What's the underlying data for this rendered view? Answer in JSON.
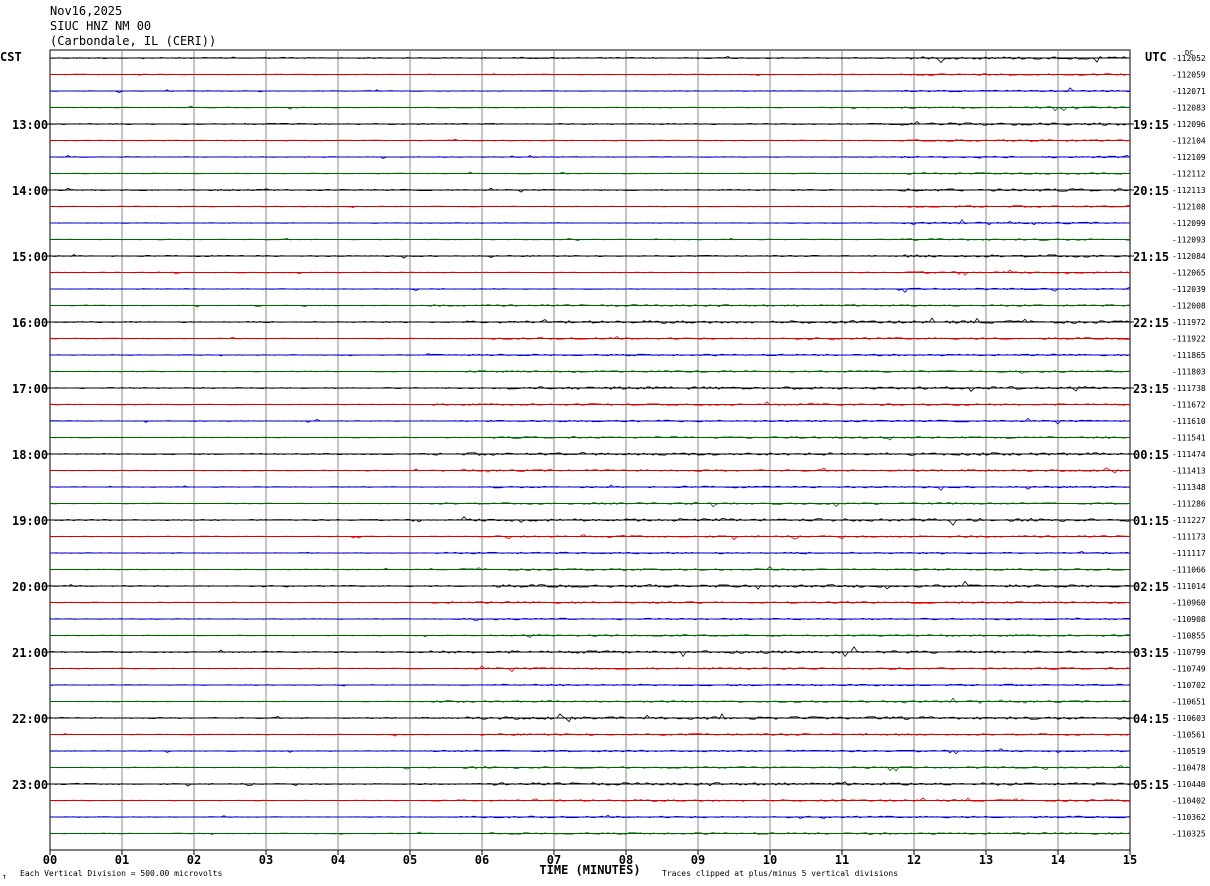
{
  "header": {
    "date": "Nov16,2025",
    "station": "SIUC HNZ NM 00",
    "location": "(Carbondale, IL (CERI))"
  },
  "labels": {
    "left_tz": "CST",
    "right_tz": "UTC",
    "dc": "DC",
    "footer_left": "Each Vertical Division =  500.00 microvolts",
    "footer_right": "Traces clipped at plus/minus 5 vertical divisions",
    "mark": "↑"
  },
  "colors": {
    "cycle": [
      "#000000",
      "#dd0000",
      "#0000cc",
      "#006600"
    ],
    "grid": "#888888"
  },
  "chart_data": {
    "type": "line",
    "xlabel": "TIME (MINUTES)",
    "x_ticks": [
      "00",
      "01",
      "02",
      "03",
      "04",
      "05",
      "06",
      "07",
      "08",
      "09",
      "10",
      "11",
      "12",
      "13",
      "14",
      "15"
    ],
    "xlim": [
      0,
      15
    ],
    "rows_per_hour": 4,
    "minutes_per_row": 15,
    "left_hours": [
      "13:00",
      "14:00",
      "15:00",
      "16:00",
      "17:00",
      "18:00",
      "19:00",
      "20:00",
      "21:00",
      "22:00",
      "23:00"
    ],
    "right_hours": [
      "19:15",
      "20:15",
      "21:15",
      "22:15",
      "23:15",
      "00:15",
      "01:15",
      "02:15",
      "03:15",
      "04:15",
      "05:15"
    ],
    "dc_offsets": [
      "-112052",
      "-112059",
      "-112071",
      "-112083",
      "-112096",
      "-112104",
      "-112109",
      "-112112",
      "-112113",
      "-112108",
      "-112099",
      "-112093",
      "-112084",
      "-112065",
      "-112039",
      "-112008",
      "-111972",
      "-111922",
      "-111865",
      "-111803",
      "-111738",
      "-111672",
      "-111610",
      "-111541",
      "-111474",
      "-111413",
      "-111348",
      "-111286",
      "-111227",
      "-111173",
      "-111117",
      "-111066",
      "-111014",
      "-110960",
      "-110908",
      "-110855",
      "-110799",
      "-110749",
      "-110702",
      "-110651",
      "-110603",
      "-110561",
      "-110519",
      "-110478",
      "-110440",
      "-110402",
      "-110362",
      "-110325"
    ]
  }
}
